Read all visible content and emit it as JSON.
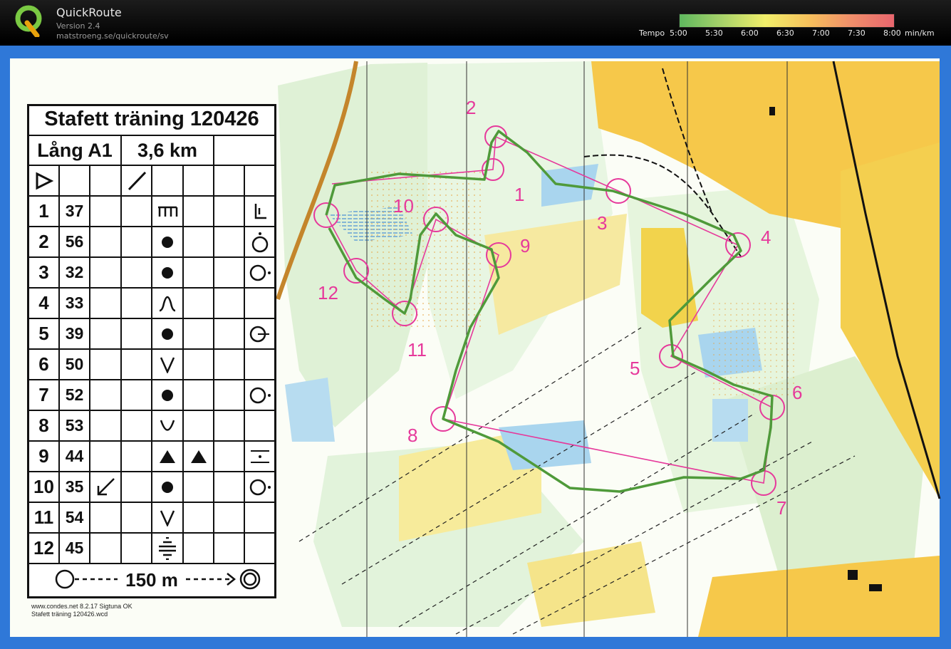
{
  "app": {
    "title": "QuickRoute",
    "version": "Version 2.4",
    "url": "matstroeng.se/quickroute/sv"
  },
  "tempo_scale": {
    "label": "Tempo",
    "ticks": [
      "5:00",
      "5:30",
      "6:00",
      "6:30",
      "7:00",
      "7:30",
      "8:00"
    ],
    "unit": "min/km",
    "colors": [
      "#5fb85f",
      "#a9d36a",
      "#f1ee6a",
      "#f6c15c",
      "#f08e6a",
      "#e8666e"
    ]
  },
  "legend": {
    "title": "Stafett träning 120426",
    "class_name": "Lång A1",
    "distance": "3,6 km",
    "controls": [
      {
        "no": "1",
        "code": "37"
      },
      {
        "no": "2",
        "code": "56"
      },
      {
        "no": "3",
        "code": "32"
      },
      {
        "no": "4",
        "code": "33"
      },
      {
        "no": "5",
        "code": "39"
      },
      {
        "no": "6",
        "code": "50"
      },
      {
        "no": "7",
        "code": "52"
      },
      {
        "no": "8",
        "code": "53"
      },
      {
        "no": "9",
        "code": "44"
      },
      {
        "no": "10",
        "code": "35"
      },
      {
        "no": "11",
        "code": "54"
      },
      {
        "no": "12",
        "code": "45"
      }
    ],
    "finish_distance": "150 m"
  },
  "credits": {
    "line1": "www.condes.net 8.2.17 Sigtuna OK",
    "line2": "Stafett träning 120426.wcd"
  },
  "course": {
    "control_labels": [
      "1",
      "2",
      "3",
      "4",
      "5",
      "6",
      "7",
      "8",
      "9",
      "10",
      "11",
      "12"
    ],
    "route_color": "#5a9a3c",
    "course_color": "#e6399b"
  }
}
